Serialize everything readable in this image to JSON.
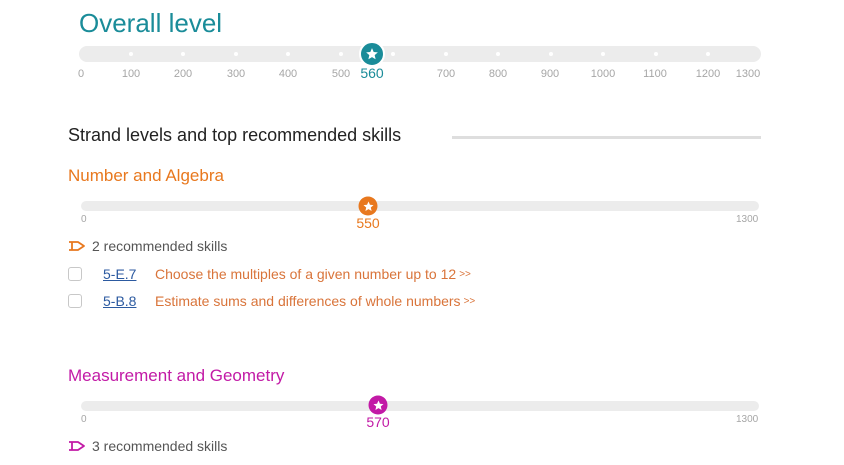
{
  "overall": {
    "title": "Overall level",
    "value": "560",
    "color": "#1a8c99",
    "scale_labels": [
      "0",
      "100",
      "200",
      "300",
      "400",
      "500",
      "700",
      "800",
      "900",
      "1000",
      "1100",
      "1200",
      "1300"
    ]
  },
  "section_heading": "Strand levels and top recommended skills",
  "strands": [
    {
      "title": "Number and Algebra",
      "color": "#e8781e",
      "value": "550",
      "min_label": "0",
      "max_label": "1300",
      "recommended_label": "2 recommended skills",
      "skills": [
        {
          "code": "5-E.7",
          "name": "Choose the multiples of a given number up to 12",
          "more": ">>"
        },
        {
          "code": "5-B.8",
          "name": "Estimate sums and differences of whole numbers",
          "more": ">>"
        }
      ]
    },
    {
      "title": "Measurement and Geometry",
      "color": "#c21aa6",
      "value": "570",
      "min_label": "0",
      "max_label": "1300",
      "recommended_label": "3 recommended skills",
      "skills": []
    }
  ]
}
